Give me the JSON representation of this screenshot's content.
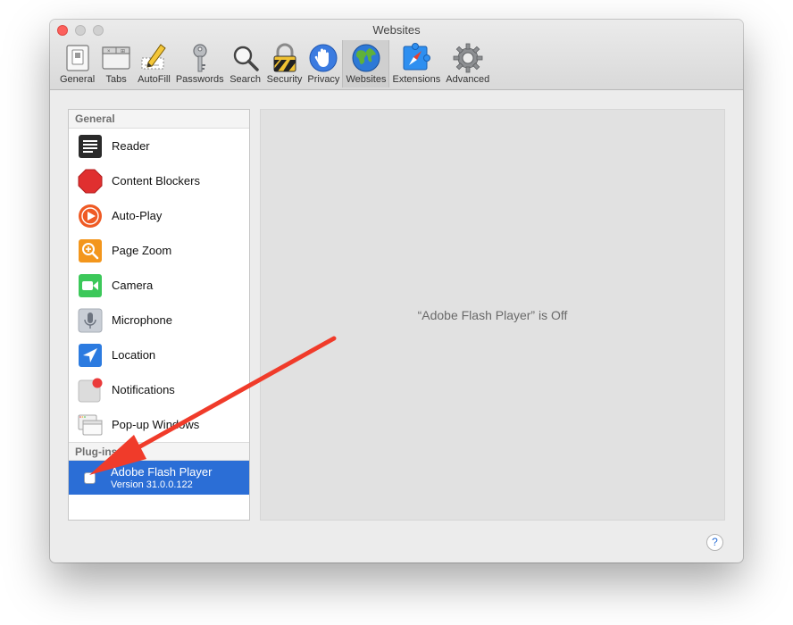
{
  "window": {
    "title": "Websites"
  },
  "toolbar": {
    "items": [
      {
        "label": "General",
        "icon": "general-switch-icon"
      },
      {
        "label": "Tabs",
        "icon": "tabs-icon"
      },
      {
        "label": "AutoFill",
        "icon": "pencil-form-icon"
      },
      {
        "label": "Passwords",
        "icon": "key-icon"
      },
      {
        "label": "Search",
        "icon": "magnifier-icon"
      },
      {
        "label": "Security",
        "icon": "padlock-icon"
      },
      {
        "label": "Privacy",
        "icon": "hand-icon"
      },
      {
        "label": "Websites",
        "icon": "globe-icon",
        "selected": true
      },
      {
        "label": "Extensions",
        "icon": "compass-puzzle-icon"
      },
      {
        "label": "Advanced",
        "icon": "gear-icon"
      }
    ]
  },
  "sidebar": {
    "general_header": "General",
    "items": [
      {
        "label": "Reader",
        "icon": "reader-icon"
      },
      {
        "label": "Content Blockers",
        "icon": "stop-sign-icon"
      },
      {
        "label": "Auto-Play",
        "icon": "play-icon"
      },
      {
        "label": "Page Zoom",
        "icon": "zoom-icon"
      },
      {
        "label": "Camera",
        "icon": "camera-icon"
      },
      {
        "label": "Microphone",
        "icon": "microphone-icon"
      },
      {
        "label": "Location",
        "icon": "location-arrow-icon"
      },
      {
        "label": "Notifications",
        "icon": "notification-badge-icon"
      },
      {
        "label": "Pop-up Windows",
        "icon": "popup-windows-icon"
      }
    ],
    "plugins_header": "Plug-ins",
    "plugin": {
      "name": "Adobe Flash Player",
      "version": "Version 31.0.0.122",
      "enabled": false
    }
  },
  "detail": {
    "message": "“Adobe Flash Player” is Off"
  },
  "help": {
    "label": "?"
  },
  "colors": {
    "selection": "#2b6ed6",
    "annotation_arrow": "#f03b2a"
  }
}
